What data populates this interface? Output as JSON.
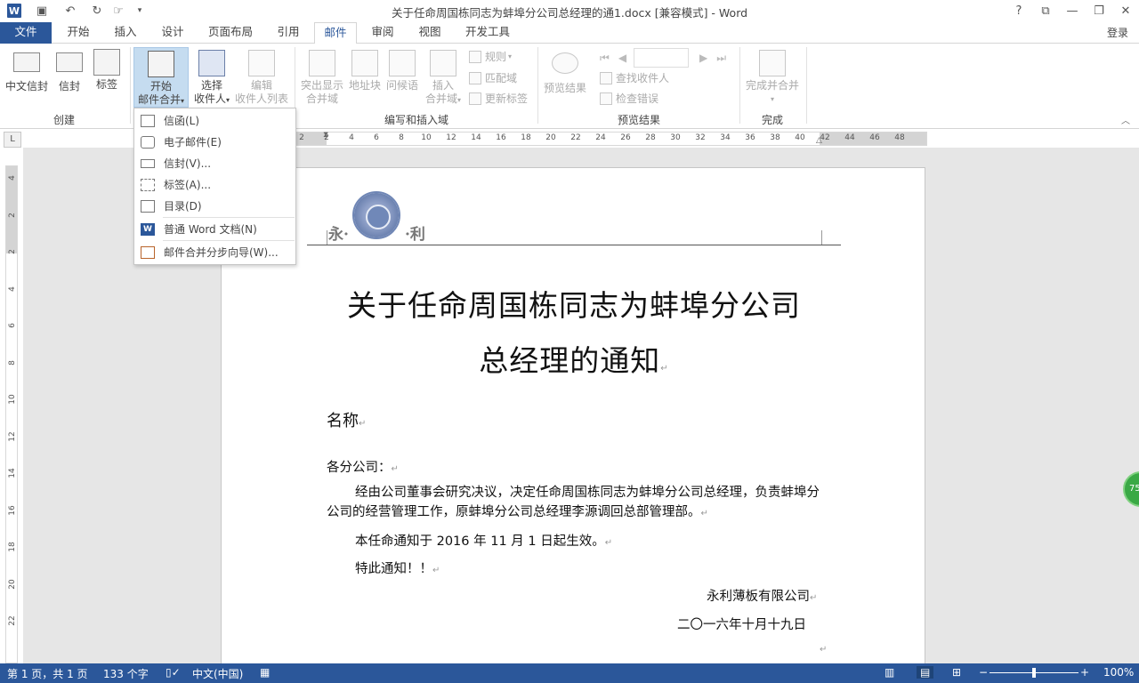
{
  "window": {
    "title": "关于任命周国栋同志为蚌埠分公司总经理的通1.docx [兼容模式] - Word",
    "help": "?",
    "login": "登录"
  },
  "tabs": [
    "文件",
    "开始",
    "插入",
    "设计",
    "页面布局",
    "引用",
    "邮件",
    "审阅",
    "视图",
    "开发工具"
  ],
  "ribbon": {
    "create": {
      "label": "创建",
      "chinese_envelope": "中文信封",
      "envelope": "信封",
      "labels": "标签"
    },
    "start": {
      "line1": "开始",
      "line2": "邮件合并"
    },
    "select": {
      "line1": "选择",
      "line2": "收件人"
    },
    "edit": {
      "line1": "编辑",
      "line2": "收件人列表"
    },
    "write": {
      "label": "编写和插入域",
      "highlight1": "突出显示",
      "highlight2": "合并域",
      "address": "地址块",
      "greeting": "问候语",
      "insert1": "插入",
      "insert2": "合并域",
      "rules": "规则",
      "match": "匹配域",
      "update": "更新标签"
    },
    "preview": {
      "label": "预览结果",
      "button": "预览结果",
      "find": "查找收件人",
      "check": "检查错误"
    },
    "finish": {
      "label": "完成",
      "button": "完成并合并"
    }
  },
  "menu": [
    {
      "label": "信函(L)"
    },
    {
      "label": "电子邮件(E)"
    },
    {
      "label": "信封(V)..."
    },
    {
      "label": "标签(A)..."
    },
    {
      "label": "目录(D)"
    },
    {
      "label": "普通 Word 文档(N)"
    },
    {
      "label": "邮件合并分步向导(W)..."
    }
  ],
  "ruler": {
    "h": [
      "2",
      "2",
      "4",
      "6",
      "8",
      "10",
      "12",
      "14",
      "16",
      "18",
      "20",
      "22",
      "24",
      "26",
      "28",
      "30",
      "32",
      "34",
      "36",
      "38",
      "40",
      "42",
      "44",
      "46",
      "48"
    ],
    "v": [
      "4",
      "2",
      "2",
      "4",
      "6",
      "8",
      "10",
      "12",
      "14",
      "16",
      "18",
      "20",
      "22"
    ]
  },
  "document": {
    "logo_left": "永·",
    "logo_right": "·利",
    "title_line1": "关于任命周国栋同志为蚌埠分公司",
    "title_line2": "总经理的通知",
    "name": "名称",
    "salutation": "各分公司：",
    "para1": "经由公司董事会研究决议，决定任命周国栋同志为蚌埠分公司总经理，负责蚌埠分公司的经营管理工作，原蚌埠分公司总经理李源调回总部管理部。",
    "para2": "本任命通知于 2016 年 11 月 1 日起生效。",
    "para3": "特此通知！！",
    "company": "永利薄板有限公司",
    "date": "二〇一六年十月十九日",
    "mark": "↵"
  },
  "status": {
    "page": "第 1 页，共 1 页",
    "words": "133 个字",
    "lang": "中文(中国)",
    "zoom": "100%",
    "zoom_level": 0.5
  },
  "bubble": "75"
}
